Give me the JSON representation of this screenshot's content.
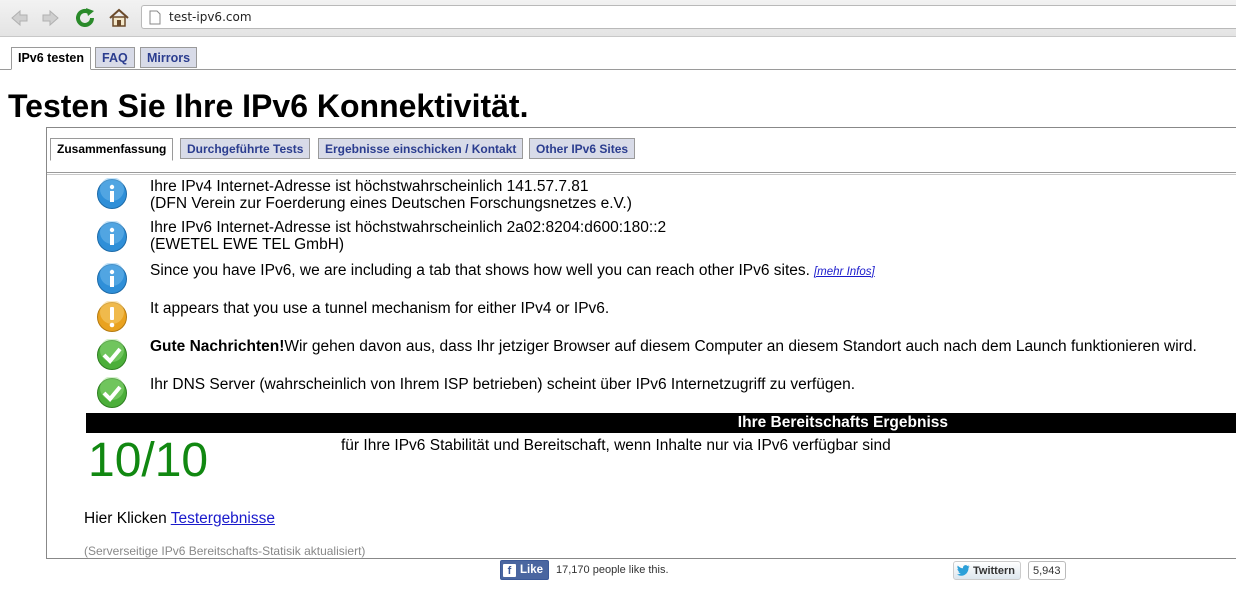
{
  "browser": {
    "url": "test-ipv6.com",
    "icons": {
      "back": "back-arrow-icon",
      "forward": "forward-arrow-icon",
      "reload": "reload-icon",
      "home": "home-icon",
      "page": "page-icon"
    }
  },
  "top_tabs": [
    {
      "label": "IPv6 testen",
      "active": true
    },
    {
      "label": "FAQ",
      "active": false
    },
    {
      "label": "Mirrors",
      "active": false
    }
  ],
  "page_title": "Testen Sie Ihre IPv6 Konnektivität.",
  "sub_tabs": [
    {
      "label": "Zusammenfassung",
      "active": true
    },
    {
      "label": "Durchgeführte Tests",
      "active": false
    },
    {
      "label": "Ergebnisse einschicken / Kontakt",
      "active": false
    },
    {
      "label": "Other IPv6 Sites",
      "active": false
    }
  ],
  "results": [
    {
      "icon": "info-icon",
      "line1": "Ihre IPv4 Internet-Adresse ist höchstwahrscheinlich 141.57.7.81",
      "line2": "(DFN Verein zur Foerderung eines Deutschen Forschungsnetzes e.V.)"
    },
    {
      "icon": "info-icon",
      "line1": "Ihre IPv6 Internet-Adresse ist höchstwahrscheinlich 2a02:8204:d600:180::2",
      "line2": "(EWETEL EWE TEL GmbH)"
    },
    {
      "icon": "info-icon",
      "line1": "Since you have IPv6, we are including a tab that shows how well you can reach other IPv6 sites.",
      "link": "[mehr Infos]"
    },
    {
      "icon": "warning-icon",
      "line1": "It appears that you use a tunnel mechanism for either IPv4 or IPv6."
    },
    {
      "icon": "check-icon",
      "bold": "Gute Nachrichten!",
      "line1": "Wir gehen davon aus, dass Ihr jetziger Browser auf diesem Computer an diesem Standort auch nach dem Launch funktionieren wird."
    },
    {
      "icon": "check-icon",
      "line1": "Ihr DNS Server (wahrscheinlich von Ihrem ISP betrieben) scheint über IPv6 Internetzugriff zu verfügen."
    }
  ],
  "readiness": {
    "header": "Ihre Bereitschafts Ergebniss",
    "score": "10/10",
    "description": "für Ihre IPv6 Stabilität und Bereitschaft, wenn Inhalte nur via IPv6 verfügbar sind"
  },
  "click_here": {
    "prefix": "Hier Klicken",
    "link": "Testergebnisse"
  },
  "stats_note": "(Serverseitige IPv6 Bereitschafts-Statisik aktualisiert)",
  "social": {
    "fb_like": "Like",
    "fb_count": "17,170 people like this.",
    "twitter": "Twittern",
    "twitter_count": "5,943"
  },
  "colors": {
    "score_green": "#118811",
    "tab_blue": "#2b3d8f",
    "link_blue": "#1a1acc",
    "info_blue": "#2f8fd8",
    "warn_orange": "#e9a21f",
    "ok_green": "#4caf3a"
  }
}
